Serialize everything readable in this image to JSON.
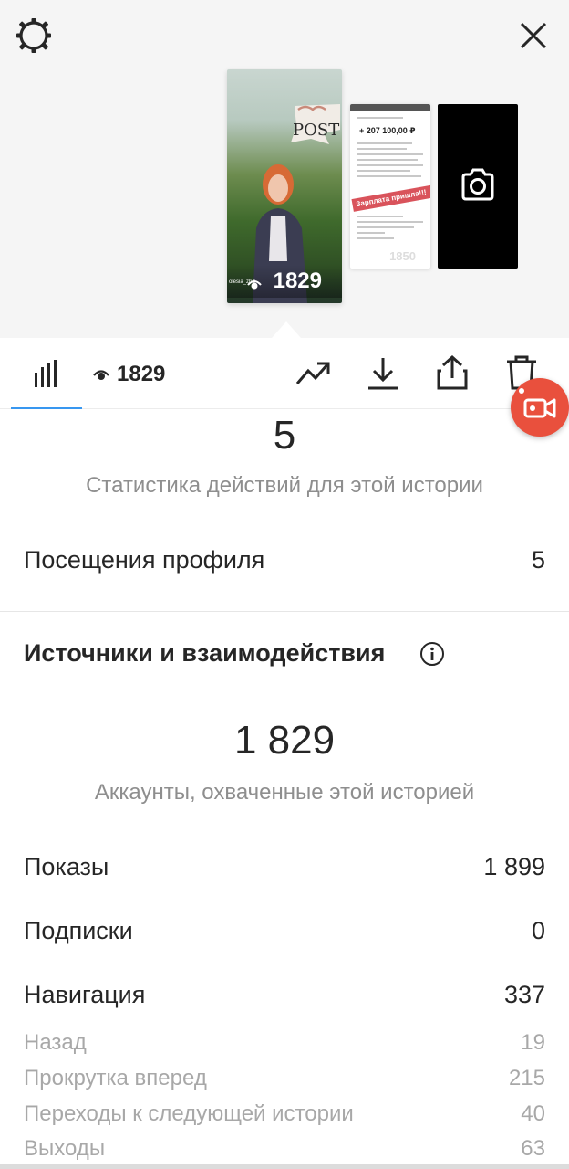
{
  "preview": {
    "main_count": "1829",
    "main_username": "olesia_zhd",
    "doc_amount": "+ 207 100,00 ₽",
    "doc_stamp": "Зарплата пришла!!!",
    "doc_count": "1850",
    "tag_text": "POST"
  },
  "toolbar": {
    "viewers_count": "1829"
  },
  "actions": {
    "total": "5",
    "subtitle": "Статистика действий для этой истории",
    "rows": [
      {
        "label": "Посещения профиля",
        "value": "5"
      }
    ]
  },
  "discovery": {
    "title": "Источники и взаимодействия",
    "reach": "1 829",
    "reach_subtitle": "Аккаунты, охваченные этой историей",
    "rows": [
      {
        "label": "Показы",
        "value": "1 899"
      },
      {
        "label": "Подписки",
        "value": "0"
      },
      {
        "label": "Навигация",
        "value": "337"
      }
    ],
    "nav_rows": [
      {
        "label": "Назад",
        "value": "19"
      },
      {
        "label": "Прокрутка вперед",
        "value": "215"
      },
      {
        "label": "Переходы к следующей истории",
        "value": "40"
      },
      {
        "label": "Выходы",
        "value": "63"
      }
    ]
  },
  "icons": {
    "settings": "gear-icon",
    "close": "close-icon",
    "stats": "bar-chart-icon",
    "eye": "eye-icon",
    "promote": "trend-up-icon",
    "download": "download-icon",
    "share": "share-icon",
    "delete": "trash-icon",
    "record": "video-record-icon",
    "info": "info-icon",
    "camera": "camera-icon"
  },
  "colors": {
    "accent_blue": "#3897f0",
    "record_red": "#e9503d",
    "text_primary": "#262626",
    "text_secondary": "#8e8e8e"
  }
}
